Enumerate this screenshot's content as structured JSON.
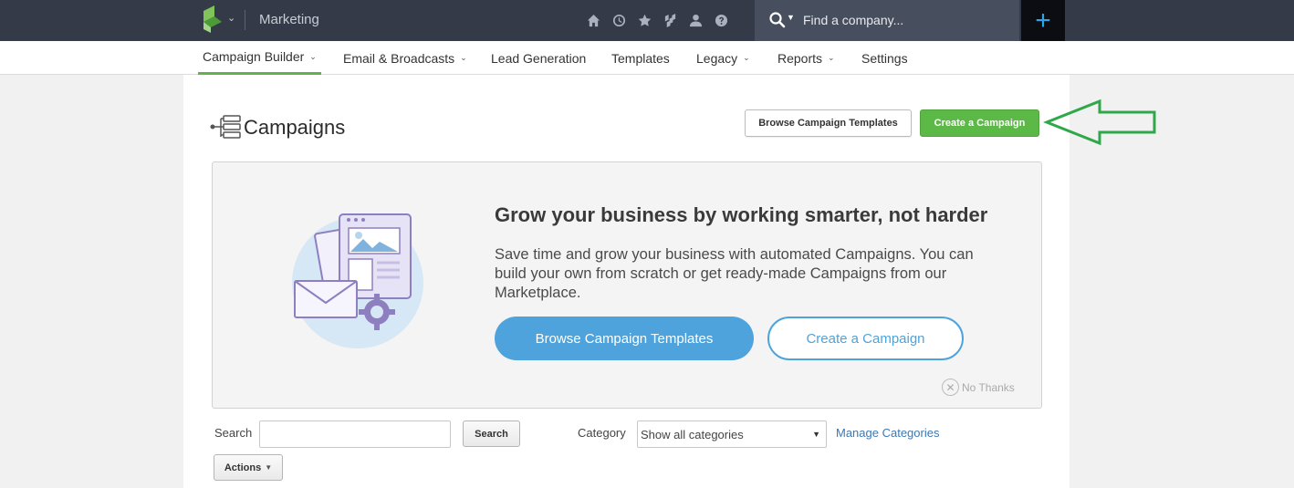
{
  "header": {
    "app_title": "Marketing",
    "search_placeholder": "Find a company...",
    "plus_label": "+",
    "icons": [
      "home-icon",
      "clock-icon",
      "star-icon",
      "apps-icon",
      "person-icon",
      "help-icon"
    ]
  },
  "nav": {
    "items": [
      {
        "label": "Campaign Builder",
        "dropdown": true,
        "active": true
      },
      {
        "label": "Email & Broadcasts",
        "dropdown": true
      },
      {
        "label": "Lead Generation",
        "dropdown": false
      },
      {
        "label": "Templates",
        "dropdown": false
      },
      {
        "label": "Legacy",
        "dropdown": true
      },
      {
        "label": "Reports",
        "dropdown": true
      },
      {
        "label": "Settings",
        "dropdown": false
      }
    ]
  },
  "page": {
    "title": "Campaigns",
    "browse_templates_label": "Browse Campaign Templates",
    "create_campaign_label": "Create a Campaign"
  },
  "promo": {
    "heading": "Grow your business by working smarter, not harder",
    "text": "Save time and grow your business with automated Campaigns. You can build your own from scratch or get ready-made Campaigns from our Marketplace.",
    "browse_label": "Browse Campaign Templates",
    "create_label": "Create a Campaign",
    "dismiss_label": "No Thanks"
  },
  "filters": {
    "search_label": "Search",
    "search_value": "",
    "search_button": "Search",
    "category_label": "Category",
    "category_selected": "Show all categories",
    "manage_link": "Manage Categories",
    "actions_label": "Actions"
  },
  "colors": {
    "topbar": "#343a48",
    "accent_green": "#5cb847",
    "accent_blue": "#4ea3dc",
    "annotation_arrow": "#2fa84a"
  }
}
